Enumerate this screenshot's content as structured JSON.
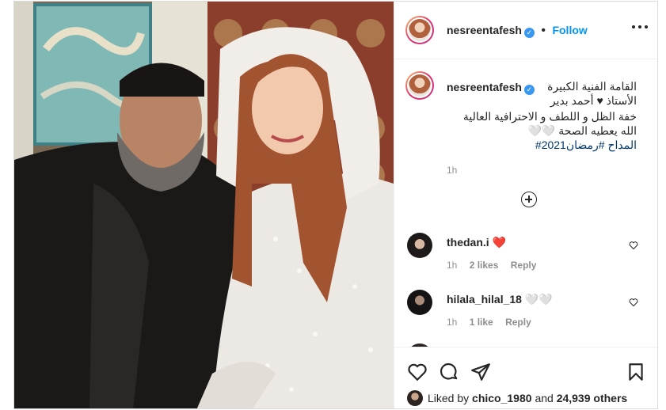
{
  "post": {
    "username": "nesreentafesh",
    "follow_label": "Follow",
    "separator": "•",
    "verified_symbol": "✓",
    "caption": {
      "line1": "القامة الفنية الكبيرة الأستاذ ♥ أحمد بدير",
      "line2": "خفة الظل و اللطف و الاحترافية العالية الله يعطيه الصحة 🤍🤍",
      "hashtags": "المداح #رمضان2021#",
      "time": "1h"
    }
  },
  "comments": [
    {
      "username": "thedan.i",
      "text": "❤️️️",
      "time": "1h",
      "likes": "2 likes",
      "reply": "Reply"
    },
    {
      "username": "hilala_hilal_18",
      "text": "🤍🤍",
      "time": "1h",
      "likes": "1 like",
      "reply": "Reply"
    }
  ],
  "likes": {
    "prefix": "Liked by",
    "user": "chico_1980",
    "and": "and",
    "others": "24,939 others"
  }
}
